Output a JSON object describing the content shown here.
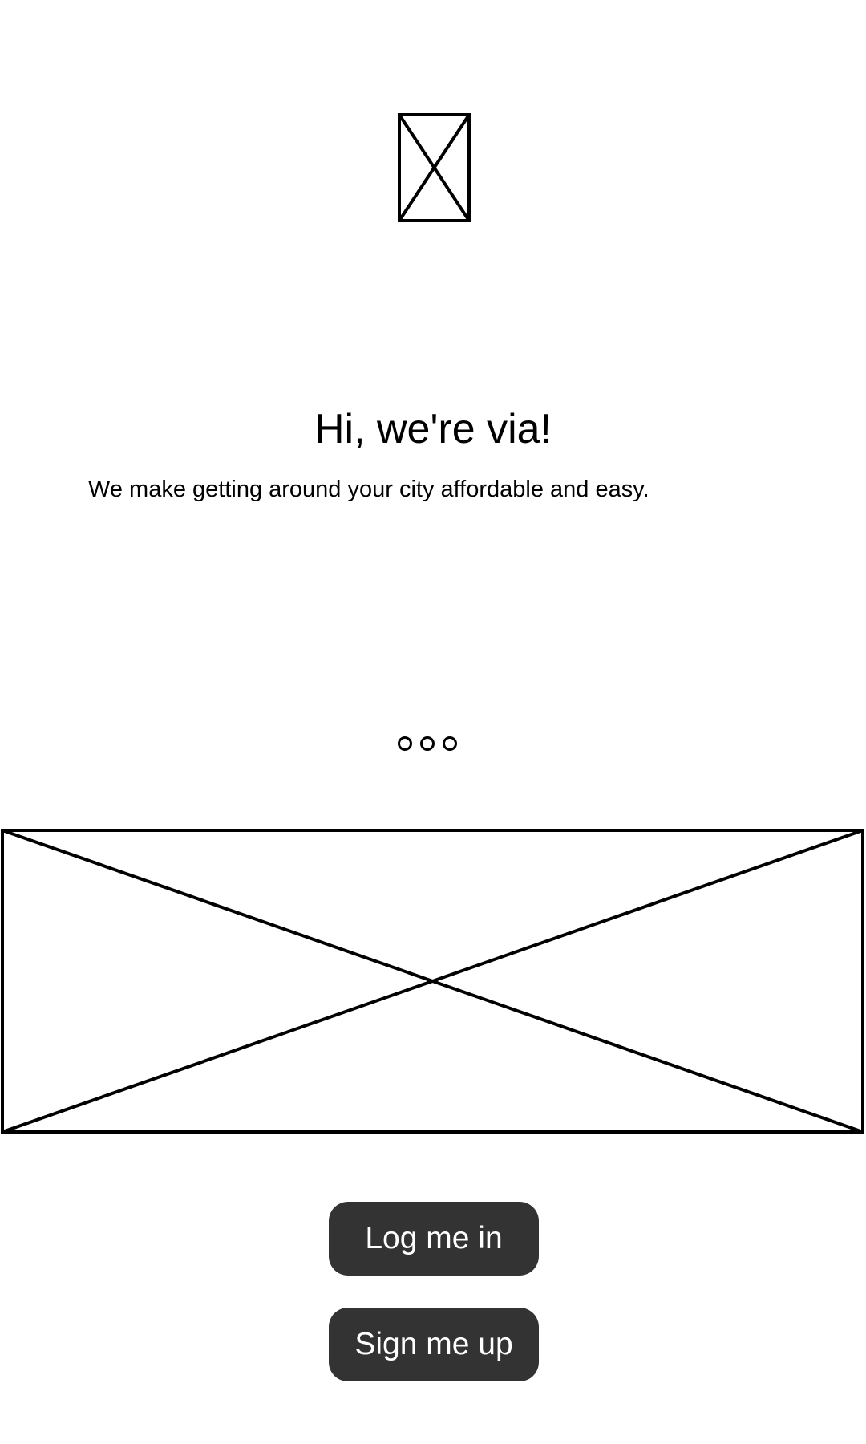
{
  "logo": {
    "icon": "image-placeholder-icon"
  },
  "intro": {
    "headline": "Hi, we're via!",
    "tagline": "We make getting around your city affordable and easy."
  },
  "pager": {
    "pages": 3,
    "icon": "page-indicator-dot"
  },
  "hero": {
    "icon": "image-placeholder-icon"
  },
  "actions": {
    "login_label": "Log me in",
    "signup_label": "Sign me up"
  },
  "colors": {
    "background": "#ffffff",
    "text": "#000000",
    "button": "#333333",
    "button_text": "#ffffff",
    "placeholder_stroke": "#000000"
  }
}
